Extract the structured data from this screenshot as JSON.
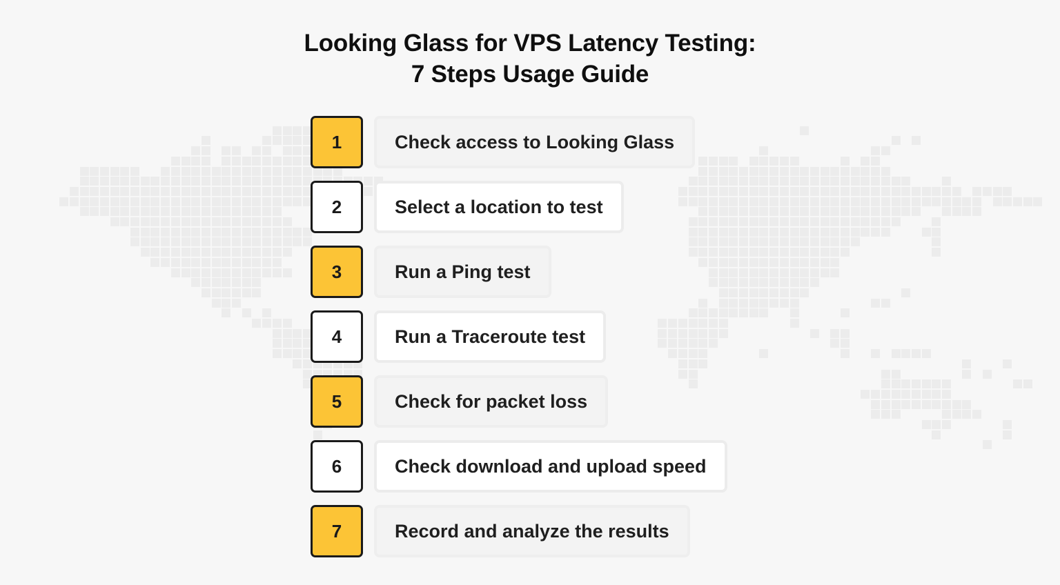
{
  "title": {
    "line1": "Looking Glass for VPS Latency Testing:",
    "line2": "7 Steps Usage Guide"
  },
  "colors": {
    "background": "#f7f7f7",
    "map_cell": "#ececec",
    "accent_yellow": "#fcc436",
    "border_dark": "#1a1a1a",
    "card_gray": "#f3f3f3",
    "card_white": "#ffffff"
  },
  "steps": [
    {
      "number": "1",
      "label": "Check access to Looking Glass",
      "style": "yellow"
    },
    {
      "number": "2",
      "label": "Select a location to test",
      "style": "white"
    },
    {
      "number": "3",
      "label": "Run a Ping test",
      "style": "yellow"
    },
    {
      "number": "4",
      "label": "Run a Traceroute test",
      "style": "white"
    },
    {
      "number": "5",
      "label": "Check for packet loss",
      "style": "yellow"
    },
    {
      "number": "6",
      "label": "Check download and upload speed",
      "style": "white"
    },
    {
      "number": "7",
      "label": "Record and analyze the results",
      "style": "yellow"
    }
  ],
  "background_map": {
    "description": "decorative pixelated world map",
    "rows": [
      "..............................................................................................................",
      "........................######..............................................#....................",
      ".................#.....#######.#.....................................................#.#..........",
      "................##.##.##.#####..........................................#..........##...............",
      "..............####.###########...............................####.####.#####....#.##..............",
      ".....######..##################...................................###################.......................",
      ".....##############################..............................######################...#..........",
      "....#################################...........................############################.####.",
      "...#########################....................................##############################.#####",
      ".....####################.........................................######################..####..",
      "........##################.......................................#####################...#.....",
      "..........##################.....................................####################...##.....",
      "..........##################.....................................#################.......#.....",
      "...........###############.......................................################........#.....",
      "............#############.........................................##############................",
      "..............############.........................................#############.................",
      "................#######............................................###########...................",
      ".................######.............................................#########.........#..........",
      "..................###.............................................#.########.......##..........",
      "...................#.#.#.........................................########..#....#...........",
      "......................####....................................#######......#.........................",
      "........................#######...............................#######........#.##....................",
      "........................########..............................######...........##.....................",
      "........................#########..............................####.....#.......#..#.####.............",
      "..........................#######...............................###.........................#...#....",
      "...........................######...............................##..................##......#.#........",
      "...........................#####.................................#..................#######......##....",
      "............................####..................................................#########.........",
      "............................###....................................................##########........",
      "............................##.....................................................###....####.......",
      "............................##..........................................................###.....#....",
      "............................#............................................................#......#....",
      "............................#.................................................................#......",
      "............................#......................................................................."
    ]
  }
}
